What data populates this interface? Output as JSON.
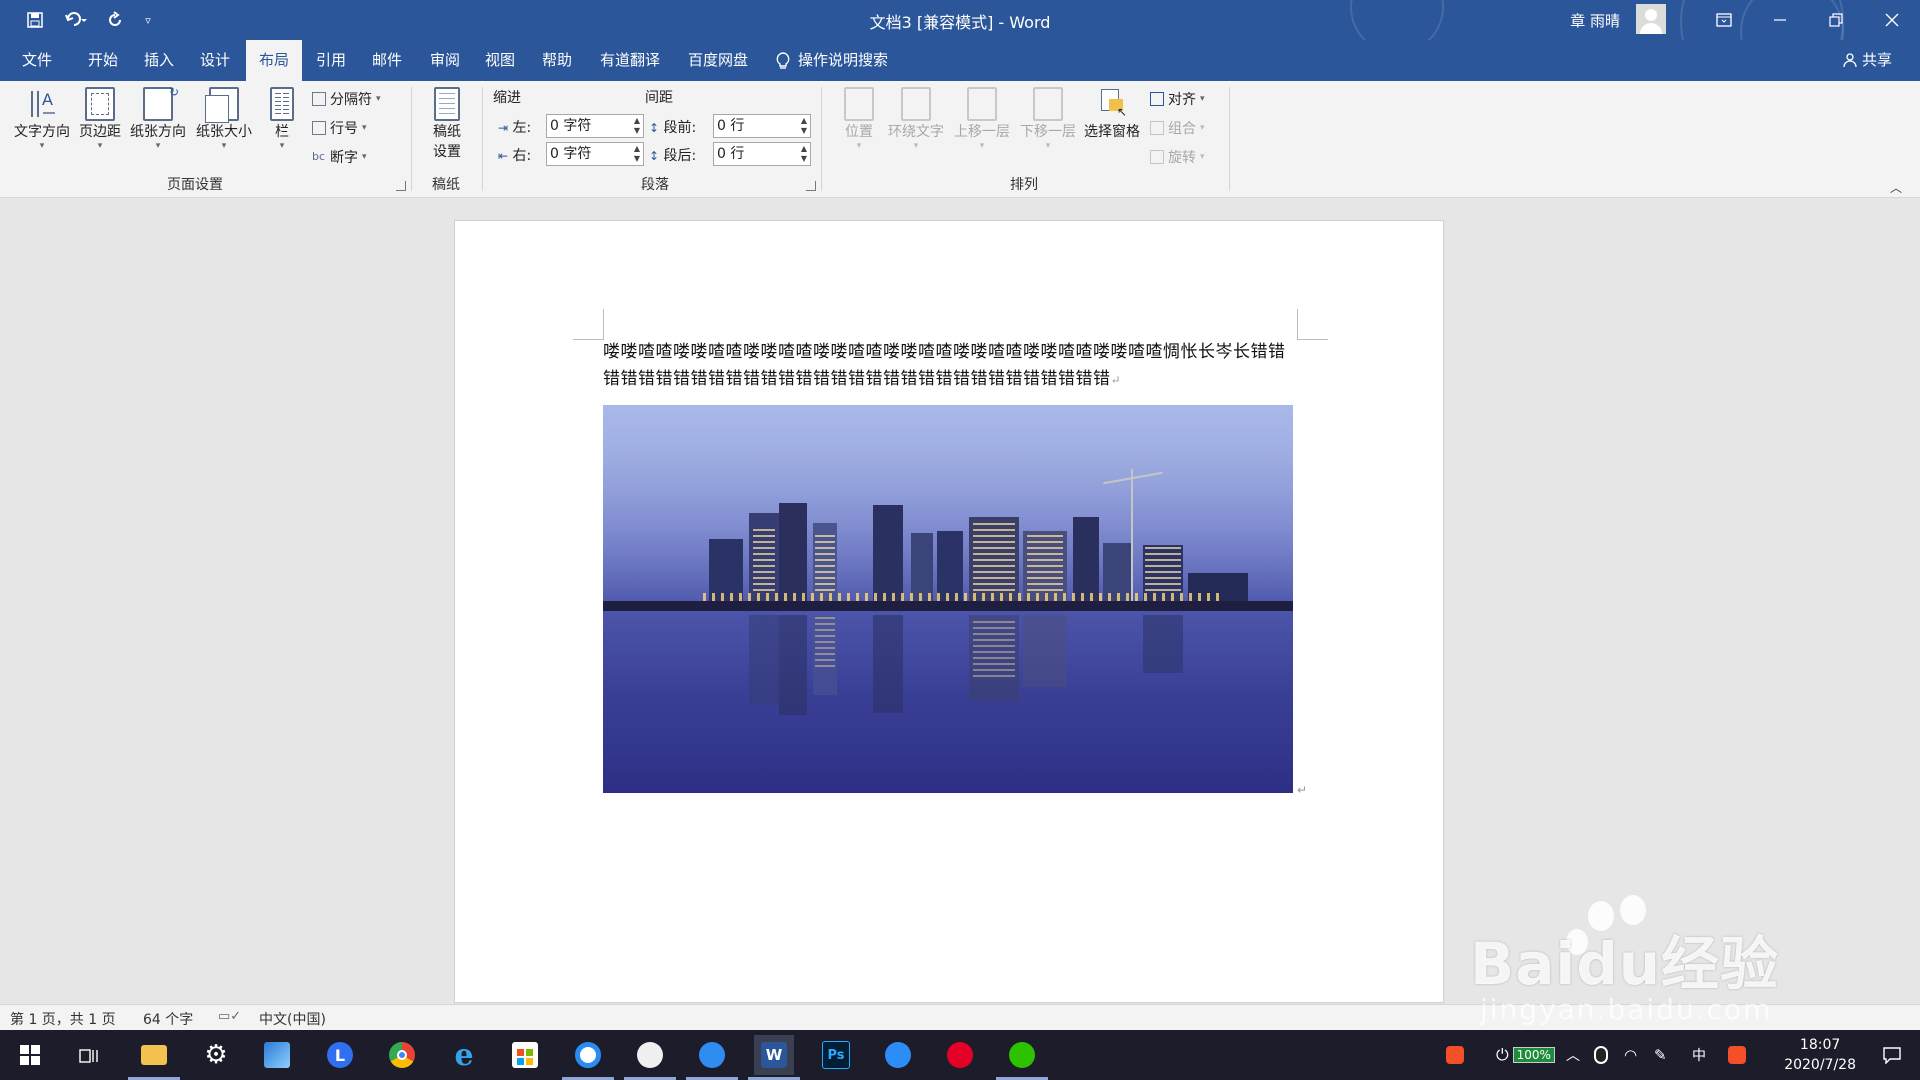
{
  "titlebar": {
    "title": "文档3 [兼容模式]  -  Word",
    "user": "章 雨晴",
    "quick_access": {
      "save_icon": "save-icon",
      "undo_icon": "undo-icon",
      "redo_icon": "redo-icon",
      "customize_icon": "customize-icon"
    },
    "window_buttons": {
      "ribbon_display": "ribbon-display-icon",
      "minimize": "minimize-icon",
      "restore": "restore-icon",
      "close": "close-icon"
    }
  },
  "tabs": [
    "文件",
    "开始",
    "插入",
    "设计",
    "布局",
    "引用",
    "邮件",
    "审阅",
    "视图",
    "帮助",
    "有道翻译",
    "百度网盘"
  ],
  "active_tab": "布局",
  "tell_me": "操作说明搜索",
  "share": "共享",
  "ribbon": {
    "page_setup": {
      "label": "页面设置",
      "buttons": [
        "文字方向",
        "页边距",
        "纸张方向",
        "纸张大小",
        "栏"
      ],
      "small": [
        "分隔符",
        "行号",
        "断字"
      ]
    },
    "manuscript": {
      "label": "稿纸",
      "button_line1": "稿纸",
      "button_line2": "设置"
    },
    "paragraph": {
      "label": "段落",
      "indent_title": "缩进",
      "spacing_title": "间距",
      "left_label": "左:",
      "left_value": "0 字符",
      "right_label": "右:",
      "right_value": "0 字符",
      "before_label": "段前:",
      "before_value": "0 行",
      "after_label": "段后:",
      "after_value": "0 行"
    },
    "arrange": {
      "label": "排列",
      "buttons": [
        "位置",
        "环绕文字",
        "上移一层",
        "下移一层",
        "选择窗格"
      ],
      "small": [
        "对齐",
        "组合",
        "旋转"
      ]
    }
  },
  "document": {
    "paragraph": "喽喽喳喳喽喽喳喳喽喽喳喳喽喽喳喳喽喽喳喳喽喽喳喳喽喽喳喳喽喽喳喳惆怅长岑长错错错错错错错错错错错错错错错错错错错错错错错错错错错错错错错"
  },
  "statusbar": {
    "page": "第 1 页，共 1 页",
    "words": "64 个字",
    "language": "中文(中国)"
  },
  "taskbar": {
    "apps": [
      "start-icon",
      "task-view-icon",
      "file-explorer-icon",
      "settings-icon",
      "photos-icon",
      "lark-icon",
      "chrome-icon",
      "ie-icon",
      "store-icon",
      "qq-browser-icon",
      "baidu-icon",
      "feishu-icon",
      "word-icon",
      "photoshop-icon",
      "sogou-icon",
      "netease-music-icon",
      "wechat-icon"
    ],
    "battery": "100%",
    "ime": "中",
    "time": "18:07",
    "date": "2020/7/28"
  },
  "watermark": {
    "main": "Baidu经验",
    "sub": "jingyan.baidu.com"
  },
  "colors": {
    "brand": "#2b579a",
    "ribbon_bg": "#f3f3f3",
    "canvas": "#e6e6e6"
  }
}
